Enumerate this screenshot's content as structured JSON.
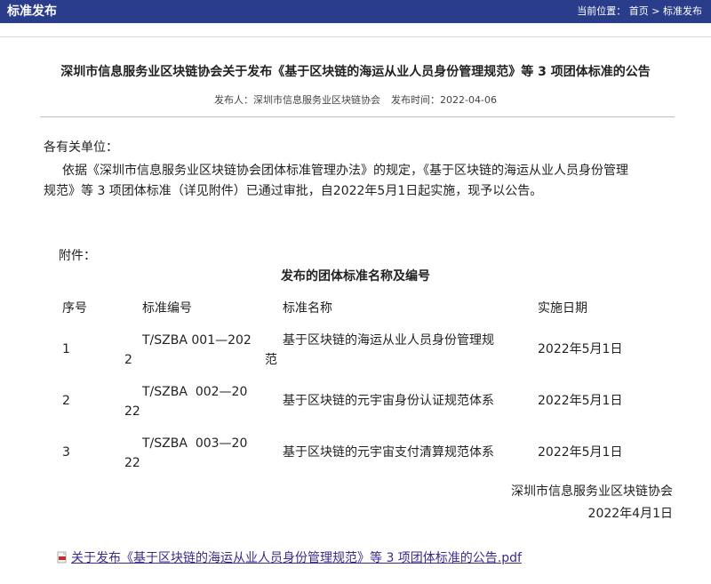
{
  "header": {
    "title": "标准发布",
    "breadcrumb": {
      "prefix": "当前位置：",
      "home": "首页",
      "sep": ">",
      "current": "标准发布"
    }
  },
  "article": {
    "title": "深圳市信息服务业区块链协会关于发布《基于区块链的海运从业人员身份管理规范》等 3 项团体标准的公告",
    "meta": {
      "publisher_label": "发布人：",
      "publisher": "深圳市信息服务业区块链协会",
      "time_label": "发布时间：",
      "time": "2022-04-06"
    },
    "greeting": "各有关单位：",
    "body_line1": "依据《深圳市信息服务业区块链协会团体标准管理办法》的规定，《基于区块链的海运从业人员身份管理",
    "body_line2": "规范》等 3 项团体标准（详见附件）已通过审批，自2022年5月1日起实施，现予以公告。",
    "attachment_label": "附件：",
    "table": {
      "title": "发布的团体标准名称及编号",
      "headers": {
        "no": "序号",
        "code": "标准编号",
        "name": "标准名称",
        "date": "实施日期"
      },
      "rows": [
        {
          "no": "1",
          "code_l1": "T/SZBA 001—202",
          "code_l2": "2",
          "name_l1": "基于区块链的海运从业人员身份管理规",
          "name_l2": "范",
          "date": "2022年5月1日"
        },
        {
          "no": "2",
          "code_l1": "T/SZBA  002—20",
          "code_l2": "22",
          "name_l1": "基于区块链的元宇宙身份认证规范体系",
          "name_l2": "",
          "date": "2022年5月1日"
        },
        {
          "no": "3",
          "code_l1": "T/SZBA  003—20",
          "code_l2": "22",
          "name_l1": "基于区块链的元宇宙支付清算规范体系",
          "name_l2": "",
          "date": "2022年5月1日"
        }
      ]
    },
    "signature": "深圳市信息服务业区块链协会",
    "sign_date": "2022年4月1日",
    "pdf_link": "关于发布《基于区块链的海运从业人员身份管理规范》等 3 项团体标准的公告.pdf",
    "icon": "pdf-file-icon"
  }
}
